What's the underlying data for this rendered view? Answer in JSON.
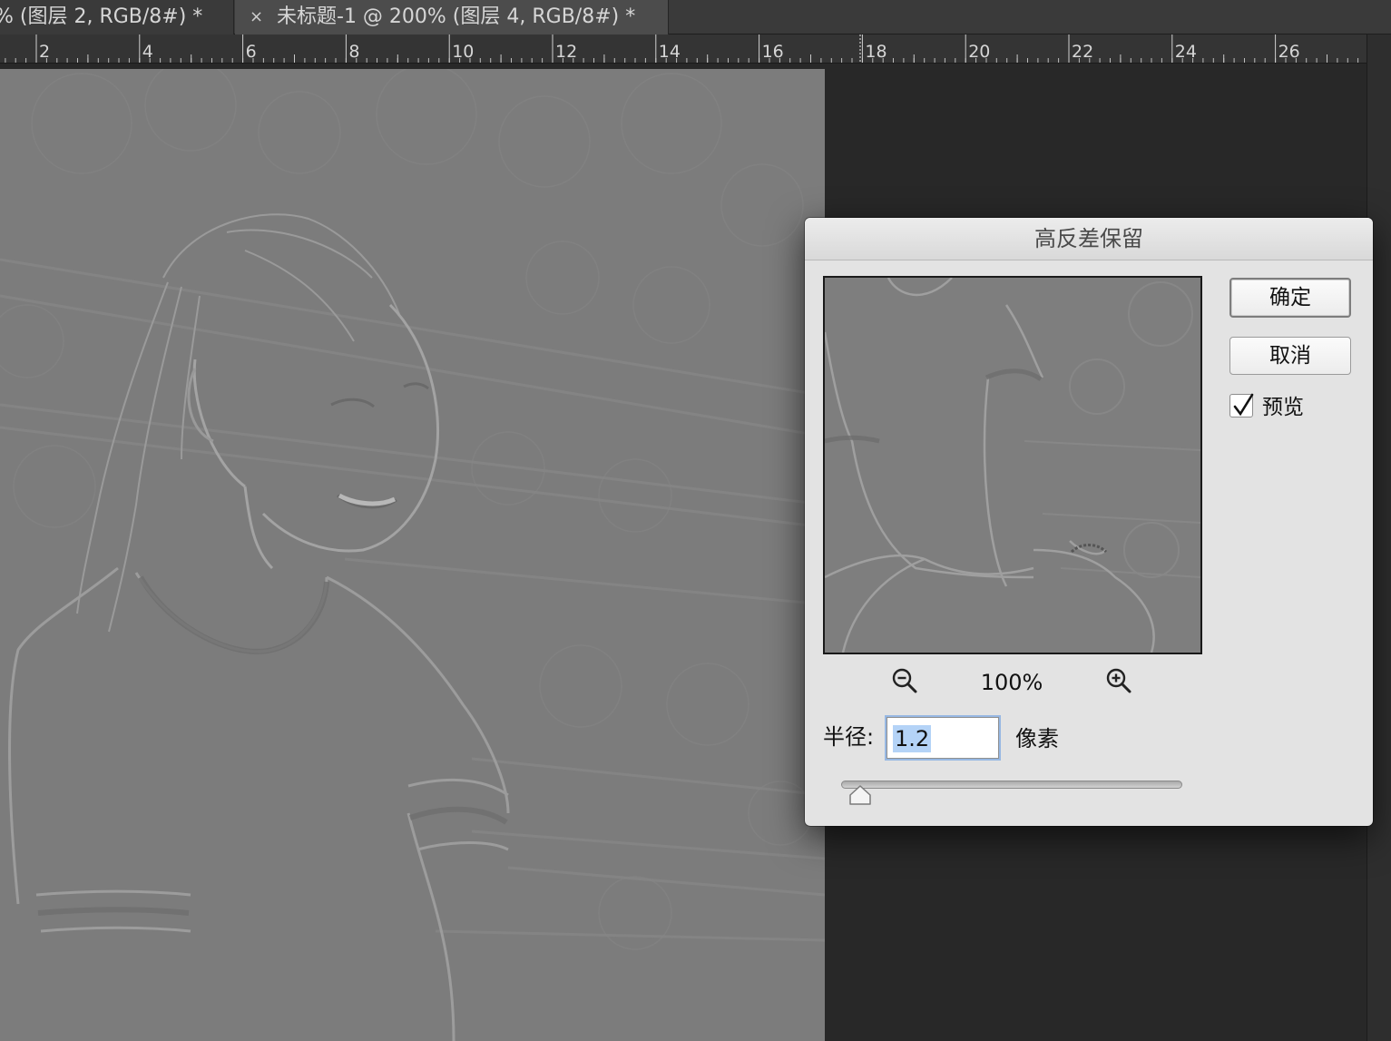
{
  "tabs": [
    {
      "label": "% (图层 2, RGB/8#) *",
      "active": false
    },
    {
      "label": "未标题-1 @ 200% (图层 4, RGB/8#) *",
      "active": true,
      "close_icon": "×"
    }
  ],
  "ruler": {
    "labels": [
      "2",
      "4",
      "6",
      "8",
      "10",
      "12",
      "14",
      "16",
      "18",
      "20",
      "22",
      "24",
      "26"
    ]
  },
  "dialog": {
    "title": "高反差保留",
    "ok_label": "确定",
    "cancel_label": "取消",
    "preview_label": "预览",
    "preview_checked": true,
    "zoom_level": "100%",
    "zoom_out_icon": "zoom-out-icon",
    "zoom_in_icon": "zoom-in-icon",
    "radius_label": "半径:",
    "radius_value": "1.2",
    "unit_label": "像素",
    "slider_value_fraction": 0.03
  },
  "colors": {
    "canvas_gray": "#7d7d7d",
    "workspace": "#282828",
    "dialog_bg": "#e3e3e3",
    "selection": "#b4d3f7"
  }
}
